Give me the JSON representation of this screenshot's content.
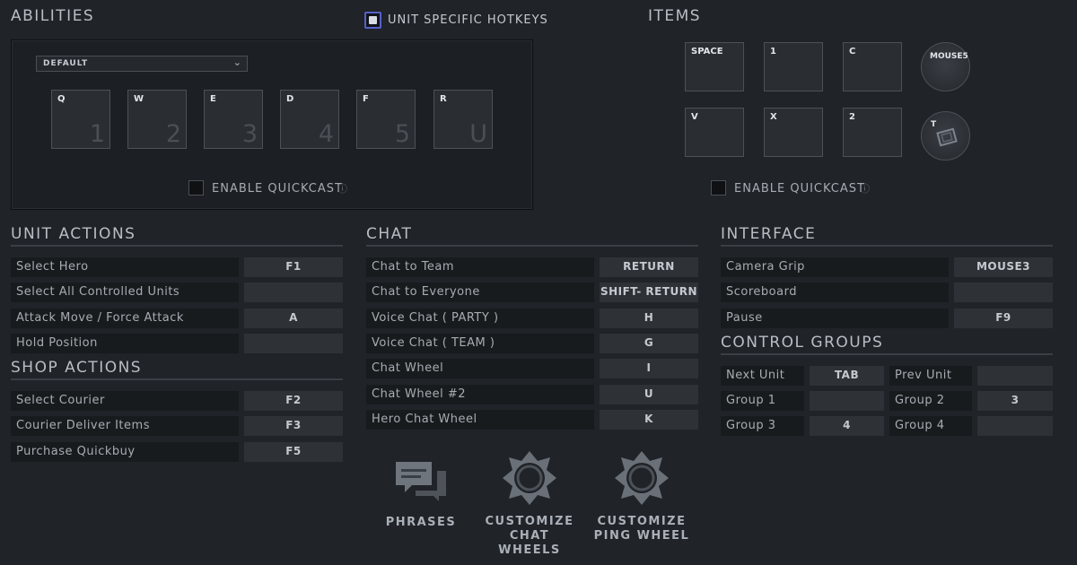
{
  "abilities": {
    "title": "ABILITIES",
    "dropdown_value": "DEFAULT",
    "keys": [
      {
        "key": "Q",
        "num": "1"
      },
      {
        "key": "W",
        "num": "2"
      },
      {
        "key": "E",
        "num": "3"
      },
      {
        "key": "D",
        "num": "4"
      },
      {
        "key": "F",
        "num": "5"
      },
      {
        "key": "R",
        "num": "U"
      }
    ],
    "quickcast_label": "ENABLE QUICKCAST",
    "quickcast_checked": false
  },
  "unit_specific": {
    "label": "UNIT SPECIFIC HOTKEYS",
    "checked": true
  },
  "items": {
    "title": "ITEMS",
    "keys": [
      "SPACE",
      "1",
      "C",
      "V",
      "X",
      "2"
    ],
    "round_keys": [
      "MOUSE5",
      "T"
    ],
    "quickcast_label": "ENABLE QUICKCAST",
    "quickcast_checked": false
  },
  "unit_actions": {
    "title": "UNIT ACTIONS",
    "rows": [
      {
        "label": "Select Hero",
        "key": "F1"
      },
      {
        "label": "Select All Controlled Units",
        "key": ""
      },
      {
        "label": "Attack Move / Force Attack",
        "key": "A"
      },
      {
        "label": "Hold Position",
        "key": ""
      }
    ]
  },
  "shop_actions": {
    "title": "SHOP ACTIONS",
    "rows": [
      {
        "label": "Select Courier",
        "key": "F2"
      },
      {
        "label": "Courier Deliver Items",
        "key": "F3"
      },
      {
        "label": "Purchase Quickbuy",
        "key": "F5"
      }
    ]
  },
  "chat": {
    "title": "CHAT",
    "rows": [
      {
        "label": "Chat to Team",
        "key": "RETURN"
      },
      {
        "label": "Chat to Everyone",
        "key": "SHIFT- RETURN"
      },
      {
        "label": "Voice Chat ( PARTY )",
        "key": "H"
      },
      {
        "label": "Voice Chat ( TEAM )",
        "key": "G"
      },
      {
        "label": "Chat Wheel",
        "key": "I"
      },
      {
        "label": "Chat Wheel #2",
        "key": "U"
      },
      {
        "label": "Hero Chat Wheel",
        "key": "K"
      }
    ]
  },
  "interface": {
    "title": "INTERFACE",
    "rows": [
      {
        "label": "Camera Grip",
        "key": "MOUSE3"
      },
      {
        "label": "Scoreboard",
        "key": ""
      },
      {
        "label": "Pause",
        "key": "F9"
      }
    ]
  },
  "control_groups": {
    "title": "CONTROL GROUPS",
    "rows": [
      {
        "left_label": "Next Unit",
        "left_key": "TAB",
        "right_label": "Prev Unit",
        "right_key": ""
      },
      {
        "left_label": "Group 1",
        "left_key": "",
        "right_label": "Group 2",
        "right_key": "3"
      },
      {
        "left_label": "Group 3",
        "left_key": "4",
        "right_label": "Group 4",
        "right_key": ""
      }
    ]
  },
  "bottom_buttons": {
    "phrases": "PHRASES",
    "chat_wheels_1": "CUSTOMIZE",
    "chat_wheels_2": "CHAT WHEELS",
    "ping_wheel_1": "CUSTOMIZE",
    "ping_wheel_2": "PING WHEEL"
  },
  "colors": {
    "background": "#202328",
    "key_box": "#2e3237",
    "label_box": "#181b1e",
    "unit_specific_accent": "#5561c9"
  }
}
